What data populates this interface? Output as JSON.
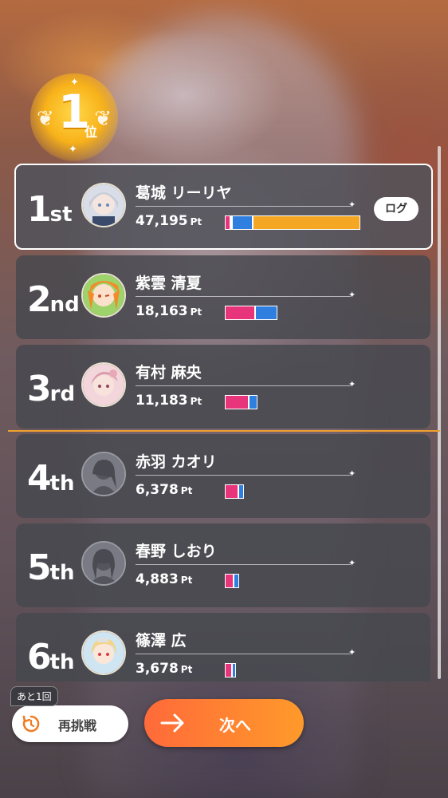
{
  "badge": {
    "number": "1",
    "kanji": "位"
  },
  "rankings": [
    {
      "place_num": "1",
      "place_suffix": "st",
      "name": "葛城 リーリヤ",
      "points": "47,195",
      "unit": "Pt",
      "log_label": "ログ"
    },
    {
      "place_num": "2",
      "place_suffix": "nd",
      "name": "紫雲 清夏",
      "points": "18,163",
      "unit": "Pt"
    },
    {
      "place_num": "3",
      "place_suffix": "rd",
      "name": "有村 麻央",
      "points": "11,183",
      "unit": "Pt"
    },
    {
      "place_num": "4",
      "place_suffix": "th",
      "name": "赤羽 カオリ",
      "points": "6,378",
      "unit": "Pt"
    },
    {
      "place_num": "5",
      "place_suffix": "th",
      "name": "春野 しおり",
      "points": "4,883",
      "unit": "Pt"
    },
    {
      "place_num": "6",
      "place_suffix": "th",
      "name": "篠澤 広",
      "points": "3,678",
      "unit": "Pt"
    }
  ],
  "footer": {
    "retry_count": "あと1回",
    "retry_label": "再挑戦",
    "next_label": "次へ"
  },
  "colors": {
    "pink": "#e8347a",
    "blue": "#2f7fe0",
    "orange": "#f5a623",
    "accent_line": "#f0a030",
    "next_button": "#ff7a30"
  },
  "icons": [
    "laurel-wreath-icon",
    "retry-clock-icon",
    "arrow-right-icon"
  ]
}
